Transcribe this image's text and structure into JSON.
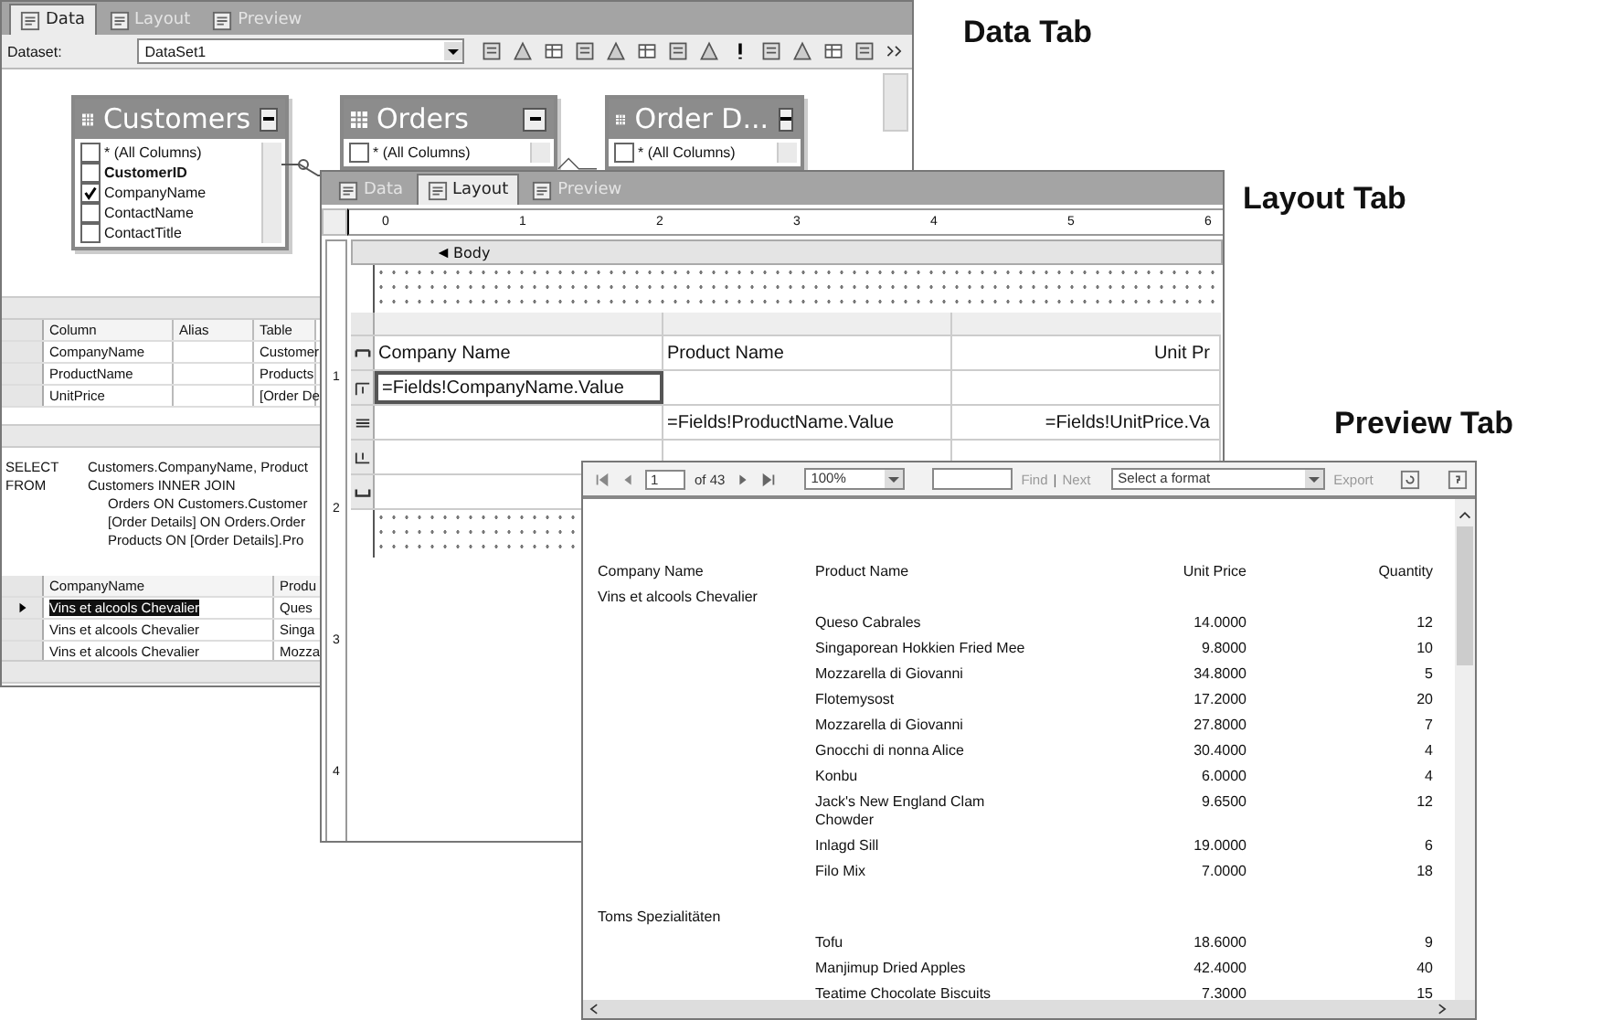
{
  "data_window": {
    "caption": "Data Tab",
    "tabs": [
      {
        "label": "Data",
        "selected": true
      },
      {
        "label": "Layout",
        "selected": false
      },
      {
        "label": "Preview",
        "selected": false
      }
    ],
    "dataset_label": "Dataset:",
    "dataset_value": "DataSet1",
    "diagram_tables": [
      {
        "title": "Customers",
        "columns": [
          {
            "name": "* (All Columns)",
            "checked": false,
            "key": false
          },
          {
            "name": "CustomerID",
            "checked": false,
            "key": true
          },
          {
            "name": "CompanyName",
            "checked": true,
            "key": false
          },
          {
            "name": "ContactName",
            "checked": false,
            "key": false
          },
          {
            "name": "ContactTitle",
            "checked": false,
            "key": false
          }
        ]
      },
      {
        "title": "Orders",
        "columns": [
          {
            "name": "* (All Columns)",
            "checked": false,
            "key": false
          }
        ]
      },
      {
        "title": "Order D...",
        "columns": [
          {
            "name": "* (All Columns)",
            "checked": false,
            "key": false
          }
        ]
      }
    ],
    "grid": {
      "columns": [
        "Column",
        "Alias",
        "Table"
      ],
      "rows": [
        {
          "column": "CompanyName",
          "table": "Customer"
        },
        {
          "column": "ProductName",
          "table": "Products"
        },
        {
          "column": "UnitPrice",
          "table": "[Order De"
        }
      ]
    },
    "sql": [
      {
        "keyword": "SELECT",
        "text": "Customers.CompanyName, Product"
      },
      {
        "keyword": "FROM",
        "text": "Customers INNER JOIN"
      },
      {
        "text": "Orders ON Customers.Customer"
      },
      {
        "text": "[Order Details] ON Orders.Order"
      },
      {
        "text": "Products ON [Order Details].Pro"
      }
    ],
    "results": {
      "columns": [
        "CompanyName",
        "Produ"
      ],
      "rows": [
        {
          "cells": [
            "Vins et alcools Chevalier",
            "Ques"
          ],
          "selected": true
        },
        {
          "cells": [
            "Vins et alcools Chevalier",
            "Singa"
          ],
          "selected": false
        },
        {
          "cells": [
            "Vins et alcools Chevalier",
            "Mozza"
          ],
          "selected": false
        }
      ]
    }
  },
  "layout_window": {
    "caption": "Layout Tab",
    "tabs": [
      {
        "label": "Data",
        "selected": false
      },
      {
        "label": "Layout",
        "selected": true
      },
      {
        "label": "Preview",
        "selected": false
      }
    ],
    "ruler_marks": [
      "0",
      "1",
      "2",
      "3",
      "4",
      "5",
      "6"
    ],
    "vertical_ruler_marks": [
      "1",
      "2",
      "3",
      "4"
    ],
    "section": "Body",
    "table_rows": [
      {
        "kind": "header",
        "cells": [
          {
            "kind": "text",
            "text": "Company Name",
            "selected": false
          },
          {
            "kind": "text",
            "text": "Product Name",
            "selected": false
          },
          {
            "kind": "text",
            "text": "Unit Pr",
            "selected": false
          }
        ]
      },
      {
        "kind": "group_header",
        "cells": [
          {
            "kind": "text",
            "text": "=Fields!CompanyName.Value",
            "selected": true
          },
          {
            "kind": "empty"
          },
          {
            "kind": "empty"
          }
        ]
      },
      {
        "kind": "detail",
        "cells": [
          {
            "kind": "empty"
          },
          {
            "kind": "text",
            "text": "=Fields!ProductName.Value",
            "selected": false
          },
          {
            "kind": "text",
            "text": "=Fields!UnitPrice.Va",
            "selected": false
          }
        ]
      },
      {
        "kind": "group_footer",
        "cells": [
          {
            "kind": "empty"
          },
          {
            "kind": "empty"
          },
          {
            "kind": "empty"
          }
        ]
      },
      {
        "kind": "footer",
        "cells": [
          {
            "kind": "empty"
          },
          {
            "kind": "empty"
          },
          {
            "kind": "empty"
          }
        ]
      }
    ]
  },
  "preview_window": {
    "caption": "Preview Tab",
    "toolbar": {
      "page": "1",
      "page_count": "of 43",
      "zoom": "100%",
      "links": [
        {
          "label": "Find",
          "disabled": true
        },
        {
          "label": "Next",
          "disabled": true
        }
      ],
      "link_separator": "|",
      "format": "Select a format",
      "export": {
        "label": "Export",
        "disabled": true
      }
    },
    "report": {
      "columns": [
        "Company Name",
        "Product Name",
        "Unit Price",
        "Quantity"
      ],
      "groups": [
        {
          "company": "Vins et alcools Chevalier",
          "items": [
            {
              "product": "Queso Cabrales",
              "price": "14.0000",
              "quantity": "12"
            },
            {
              "product": "Singaporean Hokkien Fried Mee",
              "price": "9.8000",
              "quantity": "10"
            },
            {
              "product": "Mozzarella di Giovanni",
              "price": "34.8000",
              "quantity": "5"
            },
            {
              "product": "Flotemysost",
              "price": "17.2000",
              "quantity": "20"
            },
            {
              "product": "Mozzarella di Giovanni",
              "price": "27.8000",
              "quantity": "7"
            },
            {
              "product": "Gnocchi di nonna Alice",
              "price": "30.4000",
              "quantity": "4"
            },
            {
              "product": "Konbu",
              "price": "6.0000",
              "quantity": "4"
            },
            {
              "product": "Jack's New England Clam Chowder",
              "price": "9.6500",
              "quantity": "12"
            },
            {
              "product": "Inlagd Sill",
              "price": "19.0000",
              "quantity": "6"
            },
            {
              "product": "Filo Mix",
              "price": "7.0000",
              "quantity": "18"
            }
          ]
        },
        {
          "company": "Toms Spezialitäten",
          "items": [
            {
              "product": "Tofu",
              "price": "18.6000",
              "quantity": "9"
            },
            {
              "product": "Manjimup Dried Apples",
              "price": "42.4000",
              "quantity": "40"
            },
            {
              "product": "Teatime Chocolate Biscuits",
              "price": "7.3000",
              "quantity": "15"
            }
          ]
        }
      ]
    }
  }
}
